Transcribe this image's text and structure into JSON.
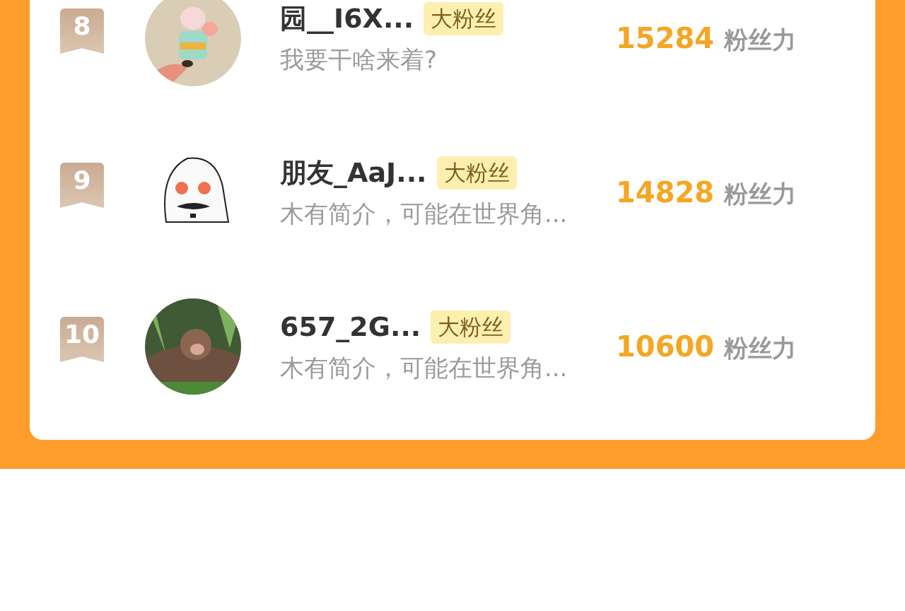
{
  "ranking": [
    {
      "rank": "8",
      "name": "园__I6X...",
      "tag": "大粉丝",
      "intro": "我要干啥来着?",
      "score": "15284",
      "unit": "粉丝力"
    },
    {
      "rank": "9",
      "name": "朋友_AaJ...",
      "tag": "大粉丝",
      "intro": "木有简介，可能在世界角...",
      "score": "14828",
      "unit": "粉丝力"
    },
    {
      "rank": "10",
      "name": "657_2G...",
      "tag": "大粉丝",
      "intro": "木有简介，可能在世界角...",
      "score": "10600",
      "unit": "粉丝力"
    }
  ]
}
